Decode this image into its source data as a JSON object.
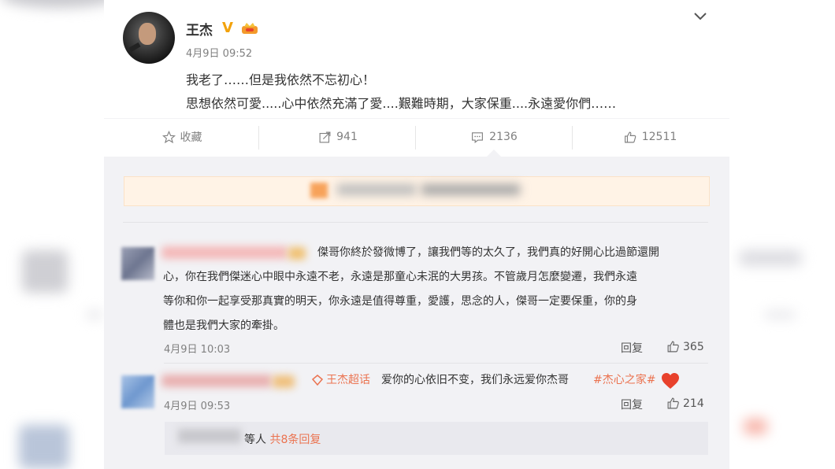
{
  "post": {
    "author": "王杰",
    "verified_badge": "V",
    "time": "4月9日 09:52",
    "lines": [
      "我老了……但是我依然不忘初心！",
      "思想依然可愛.....心中依然充滿了愛....艱難時期，大家保重....永遠愛你們……"
    ]
  },
  "actions": {
    "favorite_label": "收藏",
    "repost_count": "941",
    "comment_count": "2136",
    "like_count": "12511"
  },
  "comments": [
    {
      "text": "傑哥你終於發微博了，讓我們等的太久了，我們真的好開心比過節還開心，你在我們傑迷心中眼中永遠不老，永遠是那童心未泯的大男孩。不管歲月怎麼變遷，我們永遠等你和你一起享受那真實的明天，你永遠是值得尊重，愛護，思念的人，傑哥一定要保重，你的身體也是我們大家的牽掛。",
      "text_lines": [
        "傑哥你終於發微博了，讓我們等的太久了，我們真的好開心比過節還開",
        "心，你在我們傑迷心中眼中永遠不老，永遠是那童心未泯的大男孩。不管歲月怎麼變遷，我們永遠",
        "等你和你一起享受那真實的明天，你永遠是值得尊重，愛護，思念的人，傑哥一定要保重，你的身",
        "體也是我們大家的牽掛。"
      ],
      "time": "4月9日 10:03",
      "reply_label": "回复",
      "likes": "365"
    },
    {
      "supertopic": "王杰超话",
      "text": "爱你的心依旧不变，我们永远爱你杰哥",
      "hashtag": "#杰心之家#",
      "time": "4月9日 09:53",
      "reply_label": "回复",
      "likes": "214"
    }
  ],
  "subreplies": {
    "suffix": "等人",
    "count_text": "共8条回复"
  },
  "colors": {
    "accent": "#eb7350",
    "verified": "#f2a20c",
    "comment_bg": "#f2f2f5",
    "heart": "#e8412c"
  },
  "icons": [
    "star-icon",
    "repost-icon",
    "comment-icon",
    "like-icon",
    "chevron-down-icon",
    "crown-icon",
    "supertopic-icon",
    "heart-icon"
  ]
}
